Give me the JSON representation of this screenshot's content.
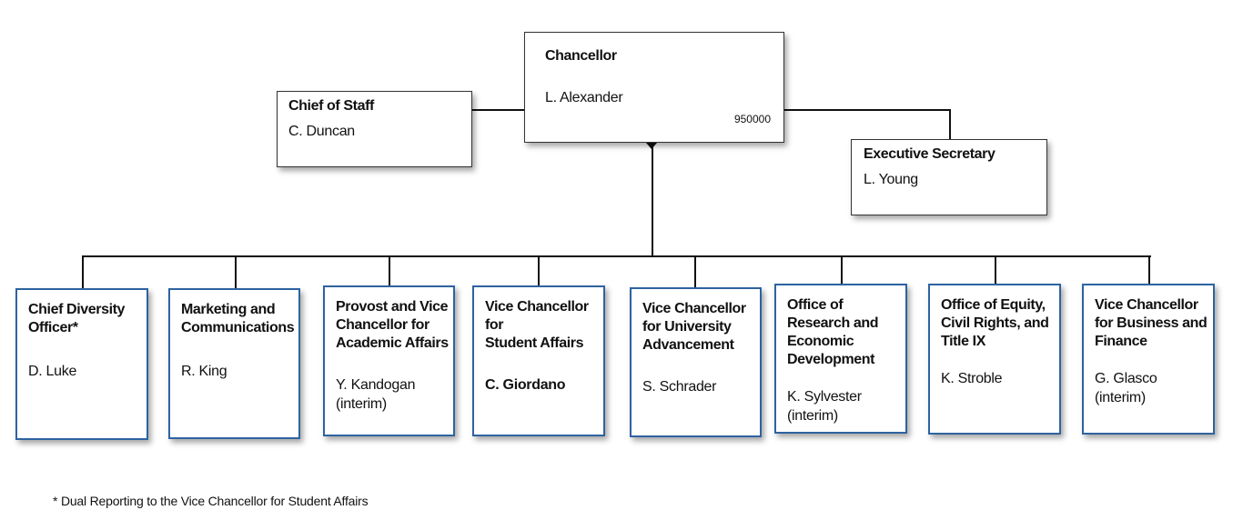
{
  "chancellor": {
    "title": "Chancellor",
    "name": "L. Alexander",
    "code": "950000"
  },
  "chief_of_staff": {
    "title": "Chief of Staff",
    "name": "C. Duncan"
  },
  "executive_secretary": {
    "title": "Executive Secretary",
    "name": "L. Young"
  },
  "units": [
    {
      "title": "Chief Diversity\nOfficer*",
      "name": "D. Luke"
    },
    {
      "title": "Marketing and\nCommunications",
      "name": "R. King"
    },
    {
      "title": "Provost and Vice\nChancellor for\nAcademic Affairs",
      "name": "Y. Kandogan\n(interim)"
    },
    {
      "title": "Vice Chancellor\nfor\nStudent Affairs",
      "name": "C. Giordano"
    },
    {
      "title": "Vice Chancellor\nfor University\nAdvancement",
      "name": "S. Schrader"
    },
    {
      "title": "Office of\nResearch and\nEconomic\nDevelopment",
      "name": "K. Sylvester\n(interim)"
    },
    {
      "title": "Office of Equity,\nCivil Rights, and\nTitle IX",
      "name": "K. Stroble"
    },
    {
      "title": "Vice Chancellor\nfor Business and\nFinance",
      "name": "G. Glasco\n(interim)"
    }
  ],
  "footnote": "*  Dual Reporting to the Vice Chancellor for Student Affairs",
  "colors": {
    "unit_border": "#2e63a0",
    "lines": "#111111"
  }
}
